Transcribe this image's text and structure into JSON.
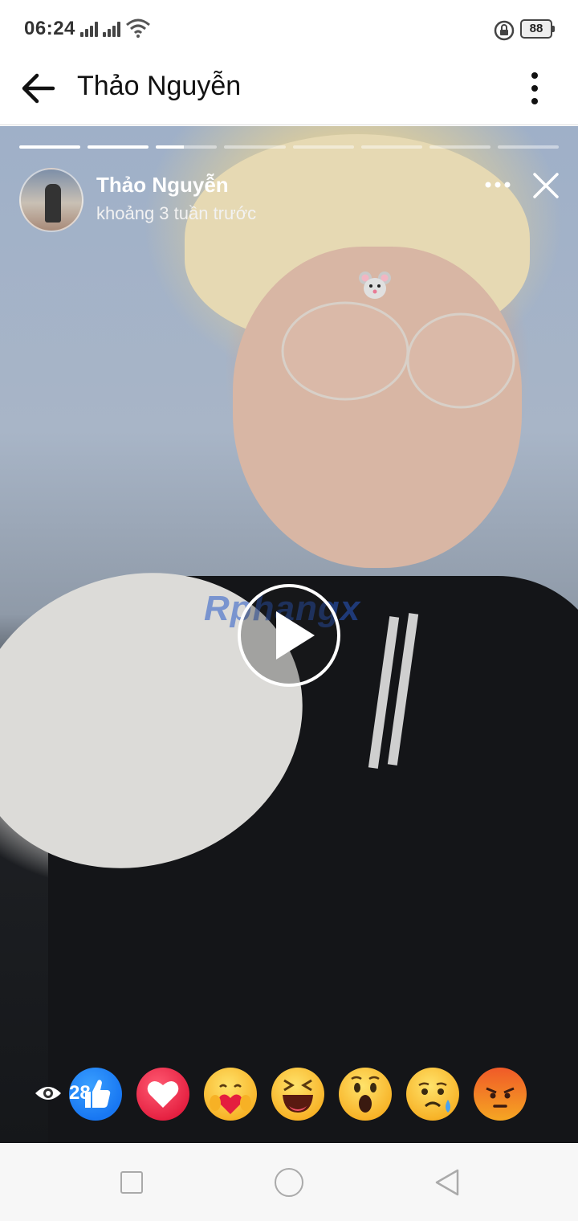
{
  "status_bar": {
    "time": "06:24",
    "battery": "88",
    "icons": [
      "signal-icon",
      "signal-icon",
      "wifi-icon",
      "rotation-lock-icon",
      "battery-icon"
    ]
  },
  "header": {
    "title": "Thảo Nguyễn",
    "back_icon": "arrow-left-icon",
    "menu_icon": "more-vertical-icon"
  },
  "story": {
    "user_name": "Thảo Nguyễn",
    "time_ago": "khoảng 3 tuần trước",
    "progress": [
      1,
      1,
      0.45,
      0,
      0,
      0,
      0,
      0
    ],
    "watermark": "Rphangx",
    "sticker": "mouse-face-icon",
    "views": "28",
    "reactions": [
      "like",
      "love",
      "care",
      "haha",
      "wow",
      "sad",
      "angry"
    ]
  },
  "nav": {
    "buttons": [
      "recent-apps",
      "home",
      "back"
    ]
  },
  "colors": {
    "like": "#1877f2",
    "love": "#e41e3f",
    "emoji_yellow": "#f7b125",
    "angry": "#f05a28"
  }
}
